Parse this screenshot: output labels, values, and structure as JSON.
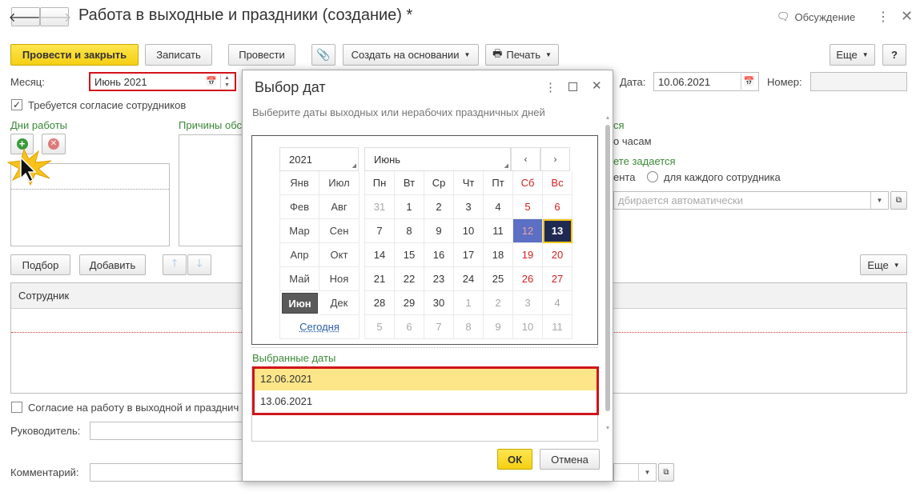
{
  "window": {
    "title": "Работа в выходные и праздники (создание) *",
    "discussion": "Обсуждение"
  },
  "toolbar": {
    "post_close": "Провести и закрыть",
    "save": "Записать",
    "post": "Провести",
    "create_based": "Создать на основании",
    "print": "Печать",
    "more": "Еще",
    "help": "?"
  },
  "form": {
    "month_label": "Месяц:",
    "month_value": "Июнь 2021",
    "date_label": "Дата:",
    "date_value": "10.06.2021",
    "number_label": "Номер:",
    "number_value": "",
    "consent_label": "Требуется согласие сотрудников",
    "work_days_label": "Дни работы",
    "reasons_label": "Причины обс",
    "right_group1_tail": "ся",
    "hours_tail": "о часам",
    "right_group2_tail": "ете задается",
    "option1_tail": "ента",
    "option2": "для каждого сотрудника",
    "auto_field": "дбирается автоматически",
    "pick_button": "Подбор",
    "add_button": "Добавить",
    "more_button": "Еще",
    "employee_header": "Сотрудник",
    "consent_work_label": "Согласие на работу в выходной и празднич",
    "manager_label": "Руководитель:",
    "comment_label": "Комментарий:"
  },
  "dialog": {
    "title": "Выбор дат",
    "hint": "Выберите даты выходных или нерабочих праздничных дней",
    "year": "2021",
    "month": "Июнь",
    "months_left": [
      "Янв",
      "Фев",
      "Мар",
      "Апр",
      "Май",
      "Июн"
    ],
    "months_right": [
      "Июл",
      "Авг",
      "Сен",
      "Окт",
      "Ноя",
      "Дек"
    ],
    "today": "Сегодня",
    "weekdays": [
      "Пн",
      "Вт",
      "Ср",
      "Чт",
      "Пт",
      "Сб",
      "Вс"
    ],
    "weeks": [
      [
        "31",
        "1",
        "2",
        "3",
        "4",
        "5",
        "6"
      ],
      [
        "7",
        "8",
        "9",
        "10",
        "11",
        "12",
        "13"
      ],
      [
        "14",
        "15",
        "16",
        "17",
        "18",
        "19",
        "20"
      ],
      [
        "21",
        "22",
        "23",
        "24",
        "25",
        "26",
        "27"
      ],
      [
        "28",
        "29",
        "30",
        "1",
        "2",
        "3",
        "4"
      ],
      [
        "5",
        "6",
        "7",
        "8",
        "9",
        "10",
        "11"
      ]
    ],
    "selected_label": "Выбранные даты",
    "selected_dates": [
      "12.06.2021",
      "13.06.2021"
    ],
    "ok": "ОК",
    "cancel": "Отмена"
  },
  "colors": {
    "accent": "#f5d21a",
    "highlight": "#d0141a",
    "green": "#3a8a36"
  }
}
